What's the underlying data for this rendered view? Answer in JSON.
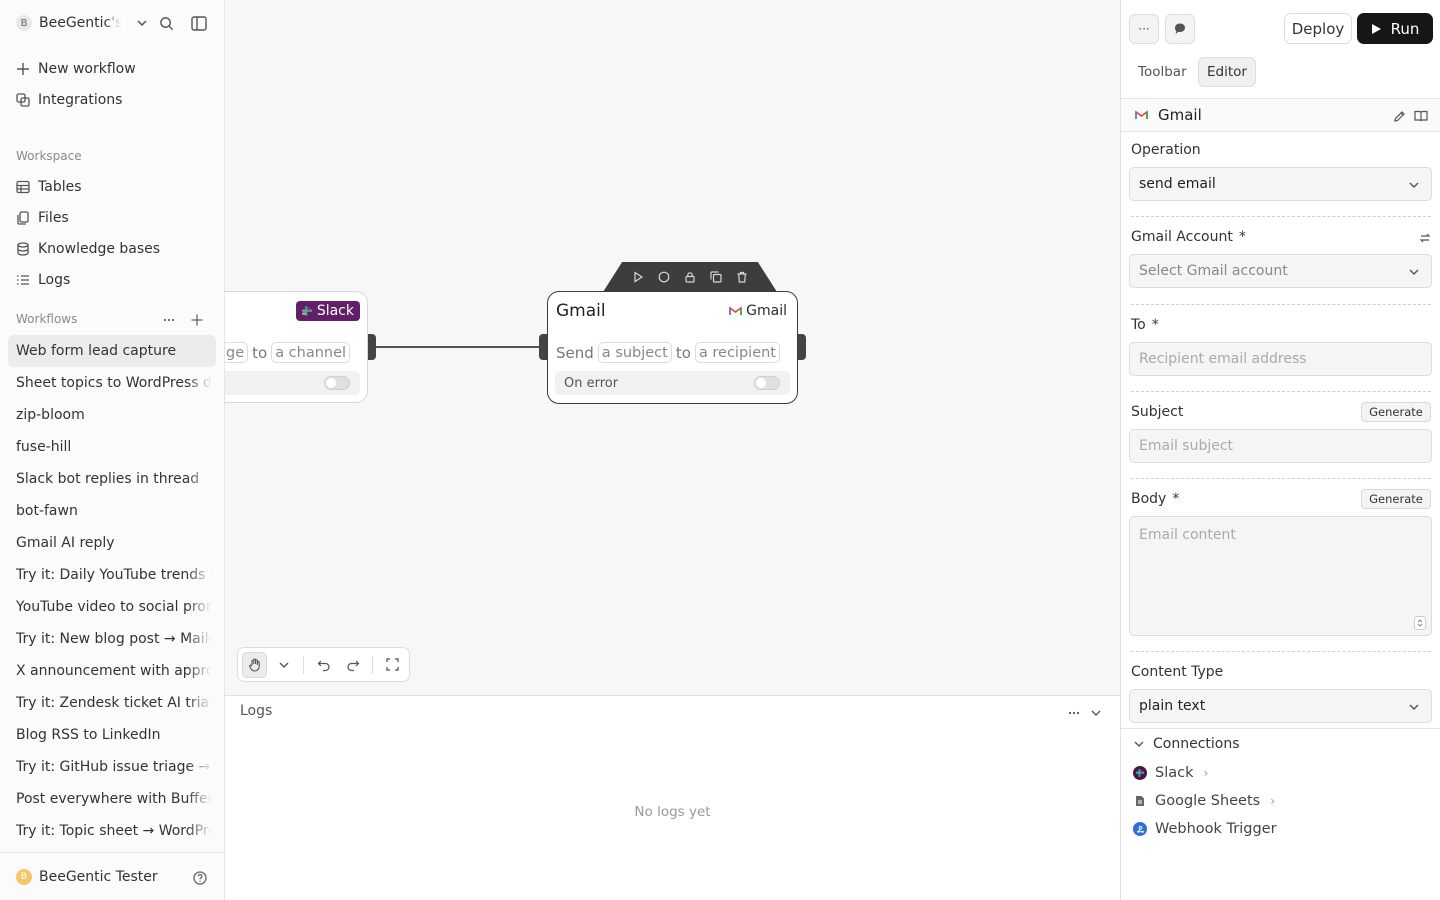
{
  "sidebar": {
    "workspace_initial": "B",
    "workspace_name": "BeeGentic's",
    "new_workflow": "New workflow",
    "integrations": "Integrations",
    "workspace_section": "Workspace",
    "workspace_items": [
      "Tables",
      "Files",
      "Knowledge bases",
      "Logs"
    ],
    "workflows_section": "Workflows",
    "workflows": [
      "Web form lead capture",
      "Sheet topics to WordPress drafts",
      "zip-bloom",
      "fuse-hill",
      "Slack bot replies in thread",
      "bot-fawn",
      "Gmail AI reply",
      "Try it: Daily YouTube trends digest",
      "YouTube video to social promo",
      "Try it: New blog post → Mailchimp",
      "X announcement with approval",
      "Try it: Zendesk ticket AI triage",
      "Blog RSS to LinkedIn",
      "Try it: GitHub issue triage → Slack",
      "Post everywhere with Buffer",
      "Try it: Topic sheet → WordPress"
    ],
    "active_workflow_index": 0,
    "user_initial": "B",
    "user_name": "BeeGentic Tester"
  },
  "canvas": {
    "slack_node": {
      "badge": "Slack",
      "body_pill_1": "ge",
      "body_word": "to",
      "body_pill_2": "a channel"
    },
    "gmail_node": {
      "title": "Gmail",
      "badge": "Gmail",
      "body_word_1": "Send",
      "body_pill_1": "a subject",
      "body_word_2": "to",
      "body_pill_2": "a recipient",
      "on_error": "On error"
    }
  },
  "logs": {
    "title": "Logs",
    "empty": "No logs yet"
  },
  "panel": {
    "more_label": "···",
    "deploy": "Deploy",
    "run": "Run",
    "tabs": [
      "Toolbar",
      "Editor"
    ],
    "active_tab": 1,
    "block_name": "Gmail",
    "operation_label": "Operation",
    "operation_value": "send email",
    "account_label": "Gmail Account",
    "account_placeholder": "Select Gmail account",
    "to_label": "To",
    "to_placeholder": "Recipient email address",
    "subject_label": "Subject",
    "subject_placeholder": "Email subject",
    "body_label": "Body",
    "body_placeholder": "Email content",
    "generate": "Generate",
    "content_type_label": "Content Type",
    "content_type_value": "plain text",
    "required_mark": "*",
    "connections_label": "Connections",
    "connections": [
      "Slack",
      "Google Sheets",
      "Webhook Trigger"
    ]
  },
  "colors": {
    "slack_badge": "#611f69",
    "run_button": "#161616",
    "user_avatar": "#f5c76b",
    "webhook_icon": "#2f6fd6"
  }
}
